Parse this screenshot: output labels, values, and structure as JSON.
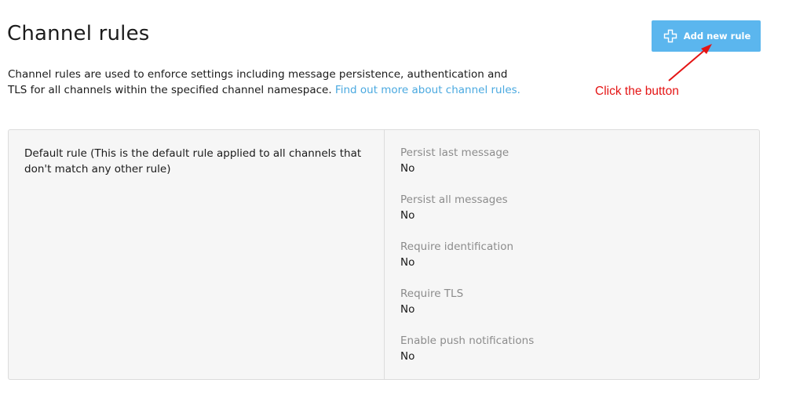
{
  "header": {
    "title": "Channel rules",
    "add_button_label": "Add new rule"
  },
  "intro": {
    "text": "Channel rules are used to enforce settings including message persistence, authentication and TLS for all channels within the specified channel namespace.",
    "link_text": "Find out more about channel rules."
  },
  "annotation": {
    "text": "Click the button"
  },
  "rule": {
    "description": "Default rule (This is the default rule applied to all channels that don't match any other rule)",
    "settings": [
      {
        "label": "Persist last message",
        "value": "No"
      },
      {
        "label": "Persist all messages",
        "value": "No"
      },
      {
        "label": "Require identification",
        "value": "No"
      },
      {
        "label": "Require TLS",
        "value": "No"
      },
      {
        "label": "Enable push notifications",
        "value": "No"
      }
    ]
  },
  "colors": {
    "accent": "#5bb6ee",
    "link": "#4aa9e0",
    "annotation": "#e41414",
    "card_background": "#f6f6f6",
    "muted_label": "#8c8c8c"
  },
  "icons": {
    "add_button": "plus-icon",
    "annotation": "arrow-icon"
  }
}
